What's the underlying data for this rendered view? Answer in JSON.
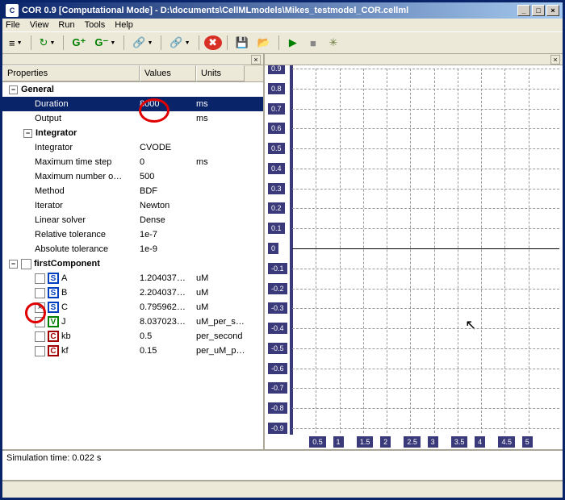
{
  "title": "COR 0.9 [Computational Mode] - D:\\documents\\CellMLmodels\\Mikes_testmodel_COR.cellml",
  "menu": {
    "file": "File",
    "view": "View",
    "run": "Run",
    "tools": "Tools",
    "help": "Help"
  },
  "toolbar": {
    "list": "≡",
    "refresh": "↻",
    "gplus": "G⁺",
    "gminus": "G⁻",
    "link1": "🔗",
    "link2": "🔗",
    "stop": "✖",
    "save": "💾",
    "open": "📂",
    "play": "▶",
    "pause": "■",
    "gear": "✳"
  },
  "headers": {
    "properties": "Properties",
    "values": "Values",
    "units": "Units"
  },
  "rows": {
    "general": {
      "label": "General"
    },
    "duration": {
      "label": "Duration",
      "value": "8000",
      "unit": "ms"
    },
    "output": {
      "label": "Output",
      "value": "",
      "unit": "ms"
    },
    "integrator_group": {
      "label": "Integrator"
    },
    "integrator": {
      "label": "Integrator",
      "value": "CVODE",
      "unit": ""
    },
    "maxstep": {
      "label": "Maximum time step",
      "value": "0",
      "unit": "ms"
    },
    "maxnum": {
      "label": "Maximum number o…",
      "value": "500",
      "unit": ""
    },
    "method": {
      "label": "Method",
      "value": "BDF",
      "unit": ""
    },
    "iterator": {
      "label": "Iterator",
      "value": "Newton",
      "unit": ""
    },
    "linsolver": {
      "label": "Linear solver",
      "value": "Dense",
      "unit": ""
    },
    "reltol": {
      "label": "Relative tolerance",
      "value": "1e-7",
      "unit": ""
    },
    "abstol": {
      "label": "Absolute tolerance",
      "value": "1e-9",
      "unit": ""
    },
    "firstcomp": {
      "label": "firstComponent"
    },
    "A": {
      "label": "A",
      "value": "1.204037…",
      "unit": "uM",
      "badge": "S"
    },
    "B": {
      "label": "B",
      "value": "2.204037…",
      "unit": "uM",
      "badge": "S"
    },
    "C": {
      "label": "C",
      "value": "0.795962…",
      "unit": "uM",
      "badge": "S",
      "checked": true
    },
    "J": {
      "label": "J",
      "value": "8.037023…",
      "unit": "uM_per_s…",
      "badge": "V"
    },
    "kb": {
      "label": "kb",
      "value": "0.5",
      "unit": "per_second",
      "badge": "C"
    },
    "kf": {
      "label": "kf",
      "value": "0.15",
      "unit": "per_uM_p…",
      "badge": "C"
    }
  },
  "status": {
    "text": "Simulation time: 0.022 s"
  },
  "chart_data": {
    "type": "line",
    "series": [],
    "xlim": [
      0,
      5.5
    ],
    "ylim": [
      -0.9,
      0.9
    ],
    "xticks": [
      0.5,
      1,
      1.5,
      2,
      2.5,
      3,
      3.5,
      4,
      4.5,
      5
    ],
    "yticks": [
      0.9,
      0.8,
      0.7,
      0.6,
      0.5,
      0.4,
      0.3,
      0.2,
      0.1,
      0,
      -0.1,
      -0.2,
      -0.3,
      -0.4,
      -0.5,
      -0.6,
      -0.7,
      -0.8,
      -0.9
    ]
  }
}
